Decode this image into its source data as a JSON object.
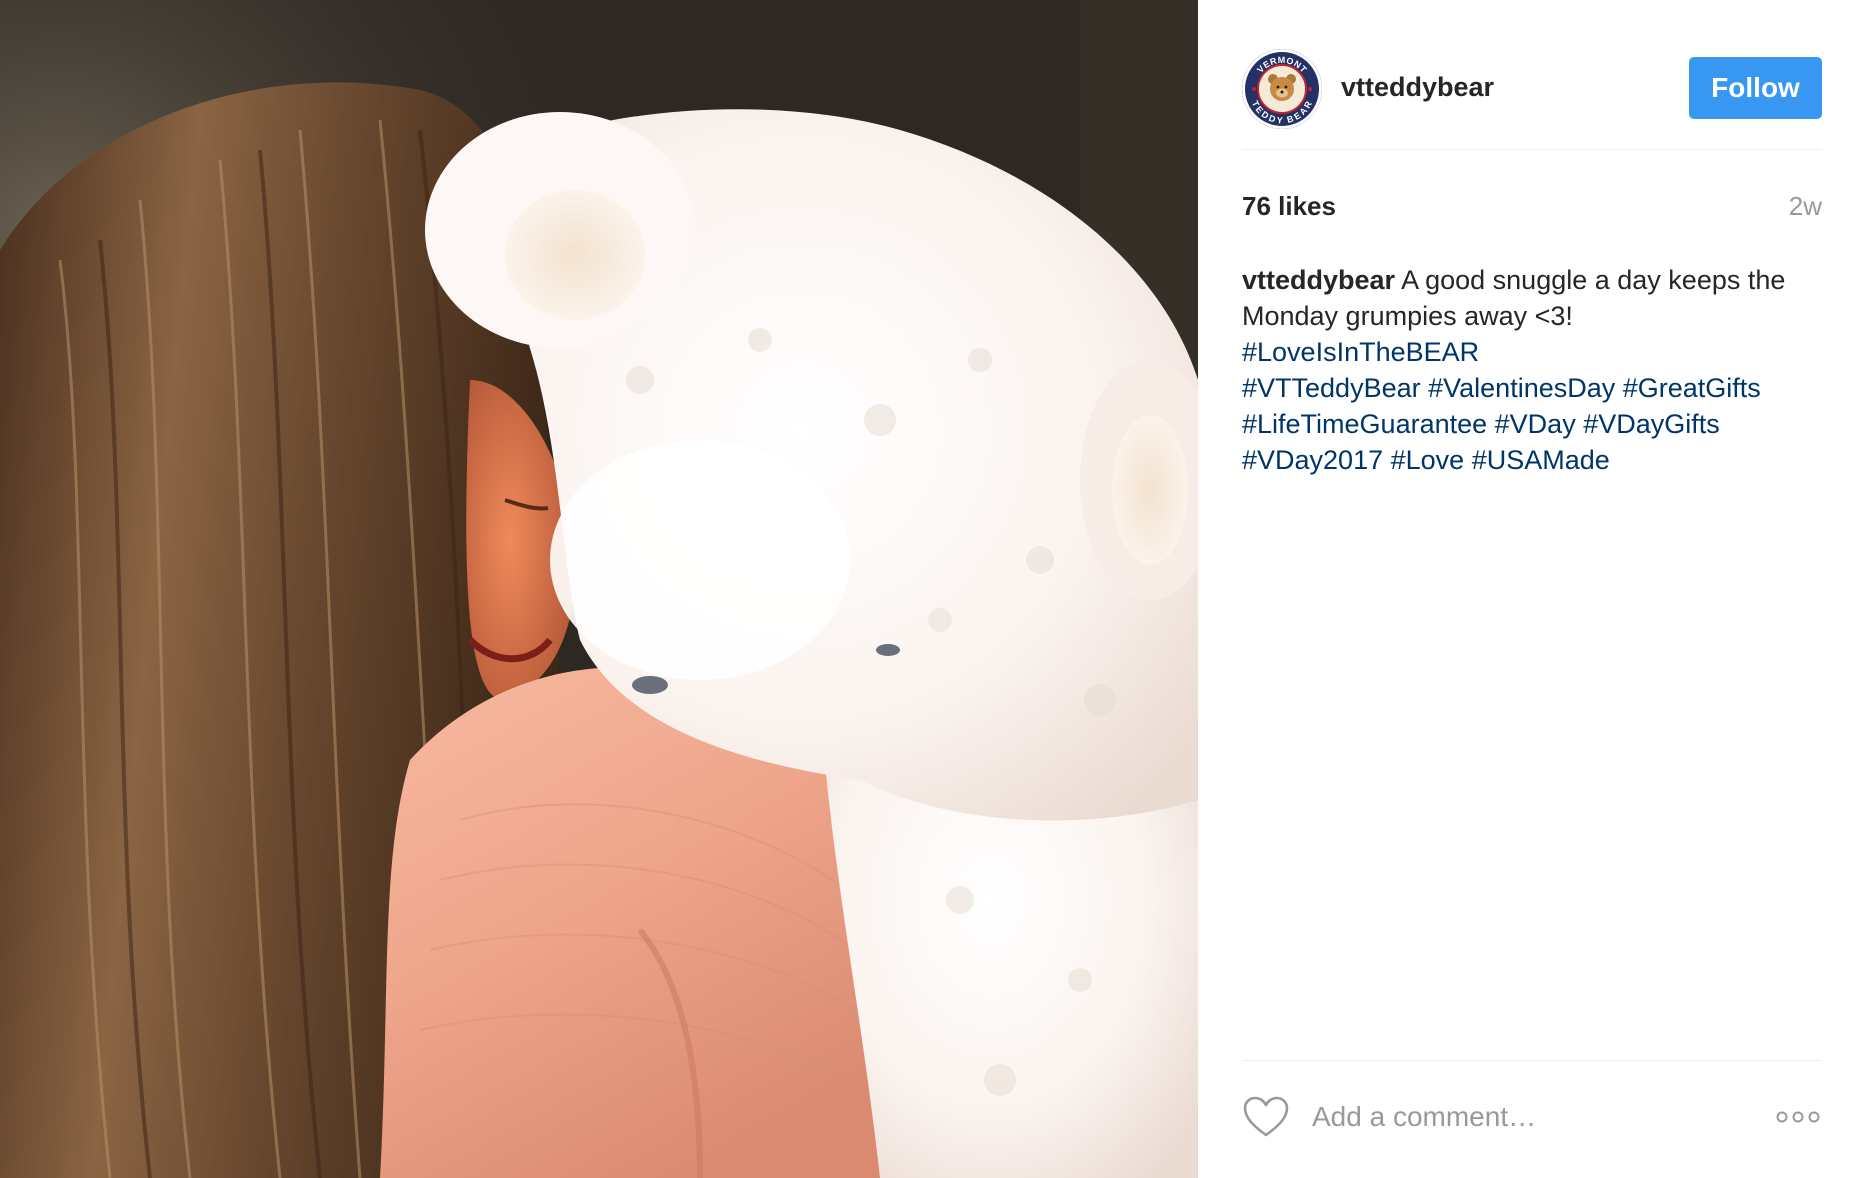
{
  "post": {
    "author": {
      "username": "vtteddybear",
      "avatar_icon": "vermont-teddy-bear-logo",
      "avatar_text_top": "VERMONT",
      "avatar_text_bottom": "TEDDY BEAR"
    },
    "follow_label": "Follow",
    "likes": "76 likes",
    "time_ago": "2w",
    "caption": {
      "username": "vtteddybear",
      "text": "A good snuggle a day keeps the Monday grumpies away <3!",
      "hashtags": [
        "#LoveIsInTheBEAR",
        "#VTTeddyBear",
        "#ValentinesDay",
        "#GreatGifts",
        "#LifeTimeGuarantee",
        "#VDay",
        "#VDayGifts",
        "#VDay2017",
        "#Love",
        "#USAMade"
      ]
    },
    "comment": {
      "placeholder": "Add a comment…",
      "like_icon": "heart-outline-icon",
      "more_icon": "more-options-icon"
    },
    "colors": {
      "follow_button": "#3897f0",
      "hashtag": "#003569",
      "muted": "#999999",
      "text": "#262626",
      "divider": "#efefef"
    }
  }
}
